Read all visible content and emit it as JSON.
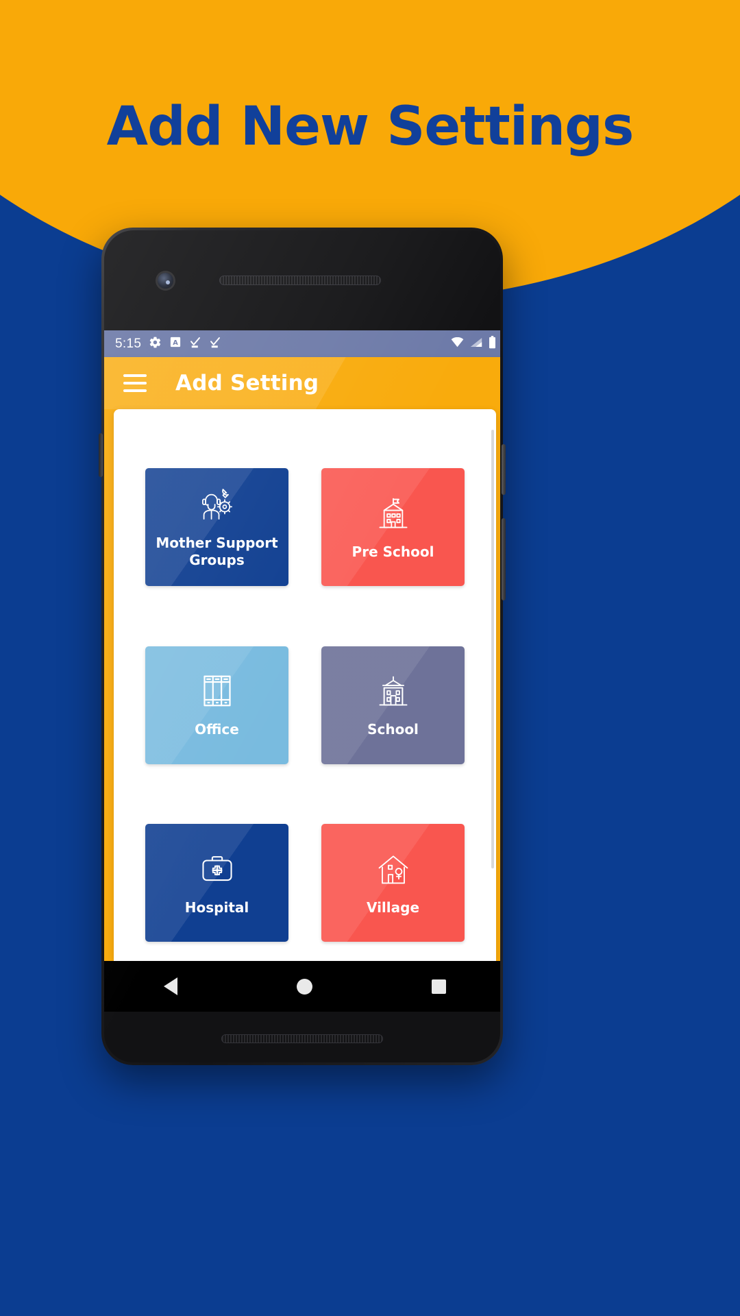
{
  "poster": {
    "headline": "Add New Settings",
    "bg_amber": "#f9a908",
    "bg_blue": "#0b3d91",
    "headline_color": "#11409a"
  },
  "phone": {
    "status_bar": {
      "time": "5:15",
      "left_icons": [
        "gear-icon",
        "a-box-icon",
        "check-download-icon",
        "check-download-icon"
      ],
      "right_icons": [
        "wifi-icon",
        "cellular-signal-icon",
        "battery-icon"
      ],
      "background": "#6d7aa8"
    },
    "app_bar": {
      "menu_icon": "hamburger-menu-icon",
      "title": "Add Setting",
      "background": "#f9ab0c"
    },
    "nav_bar": {
      "back": "back-triangle-icon",
      "home": "home-circle-icon",
      "recents": "recents-square-icon"
    }
  },
  "settings_grid": {
    "tiles": [
      {
        "label": "Mother Support Groups",
        "icon": "support-agent-icon",
        "color": "#103f91"
      },
      {
        "label": "Pre School",
        "icon": "pre-school-building-icon",
        "color": "#f9564f"
      },
      {
        "label": "Office",
        "icon": "office-binders-icon",
        "color": "#79bbdf"
      },
      {
        "label": "School",
        "icon": "school-building-icon",
        "color": "#6e7299"
      },
      {
        "label": "Hospital",
        "icon": "medical-kit-icon",
        "color": "#103f91"
      },
      {
        "label": "Village",
        "icon": "village-house-icon",
        "color": "#f9564f"
      }
    ]
  }
}
